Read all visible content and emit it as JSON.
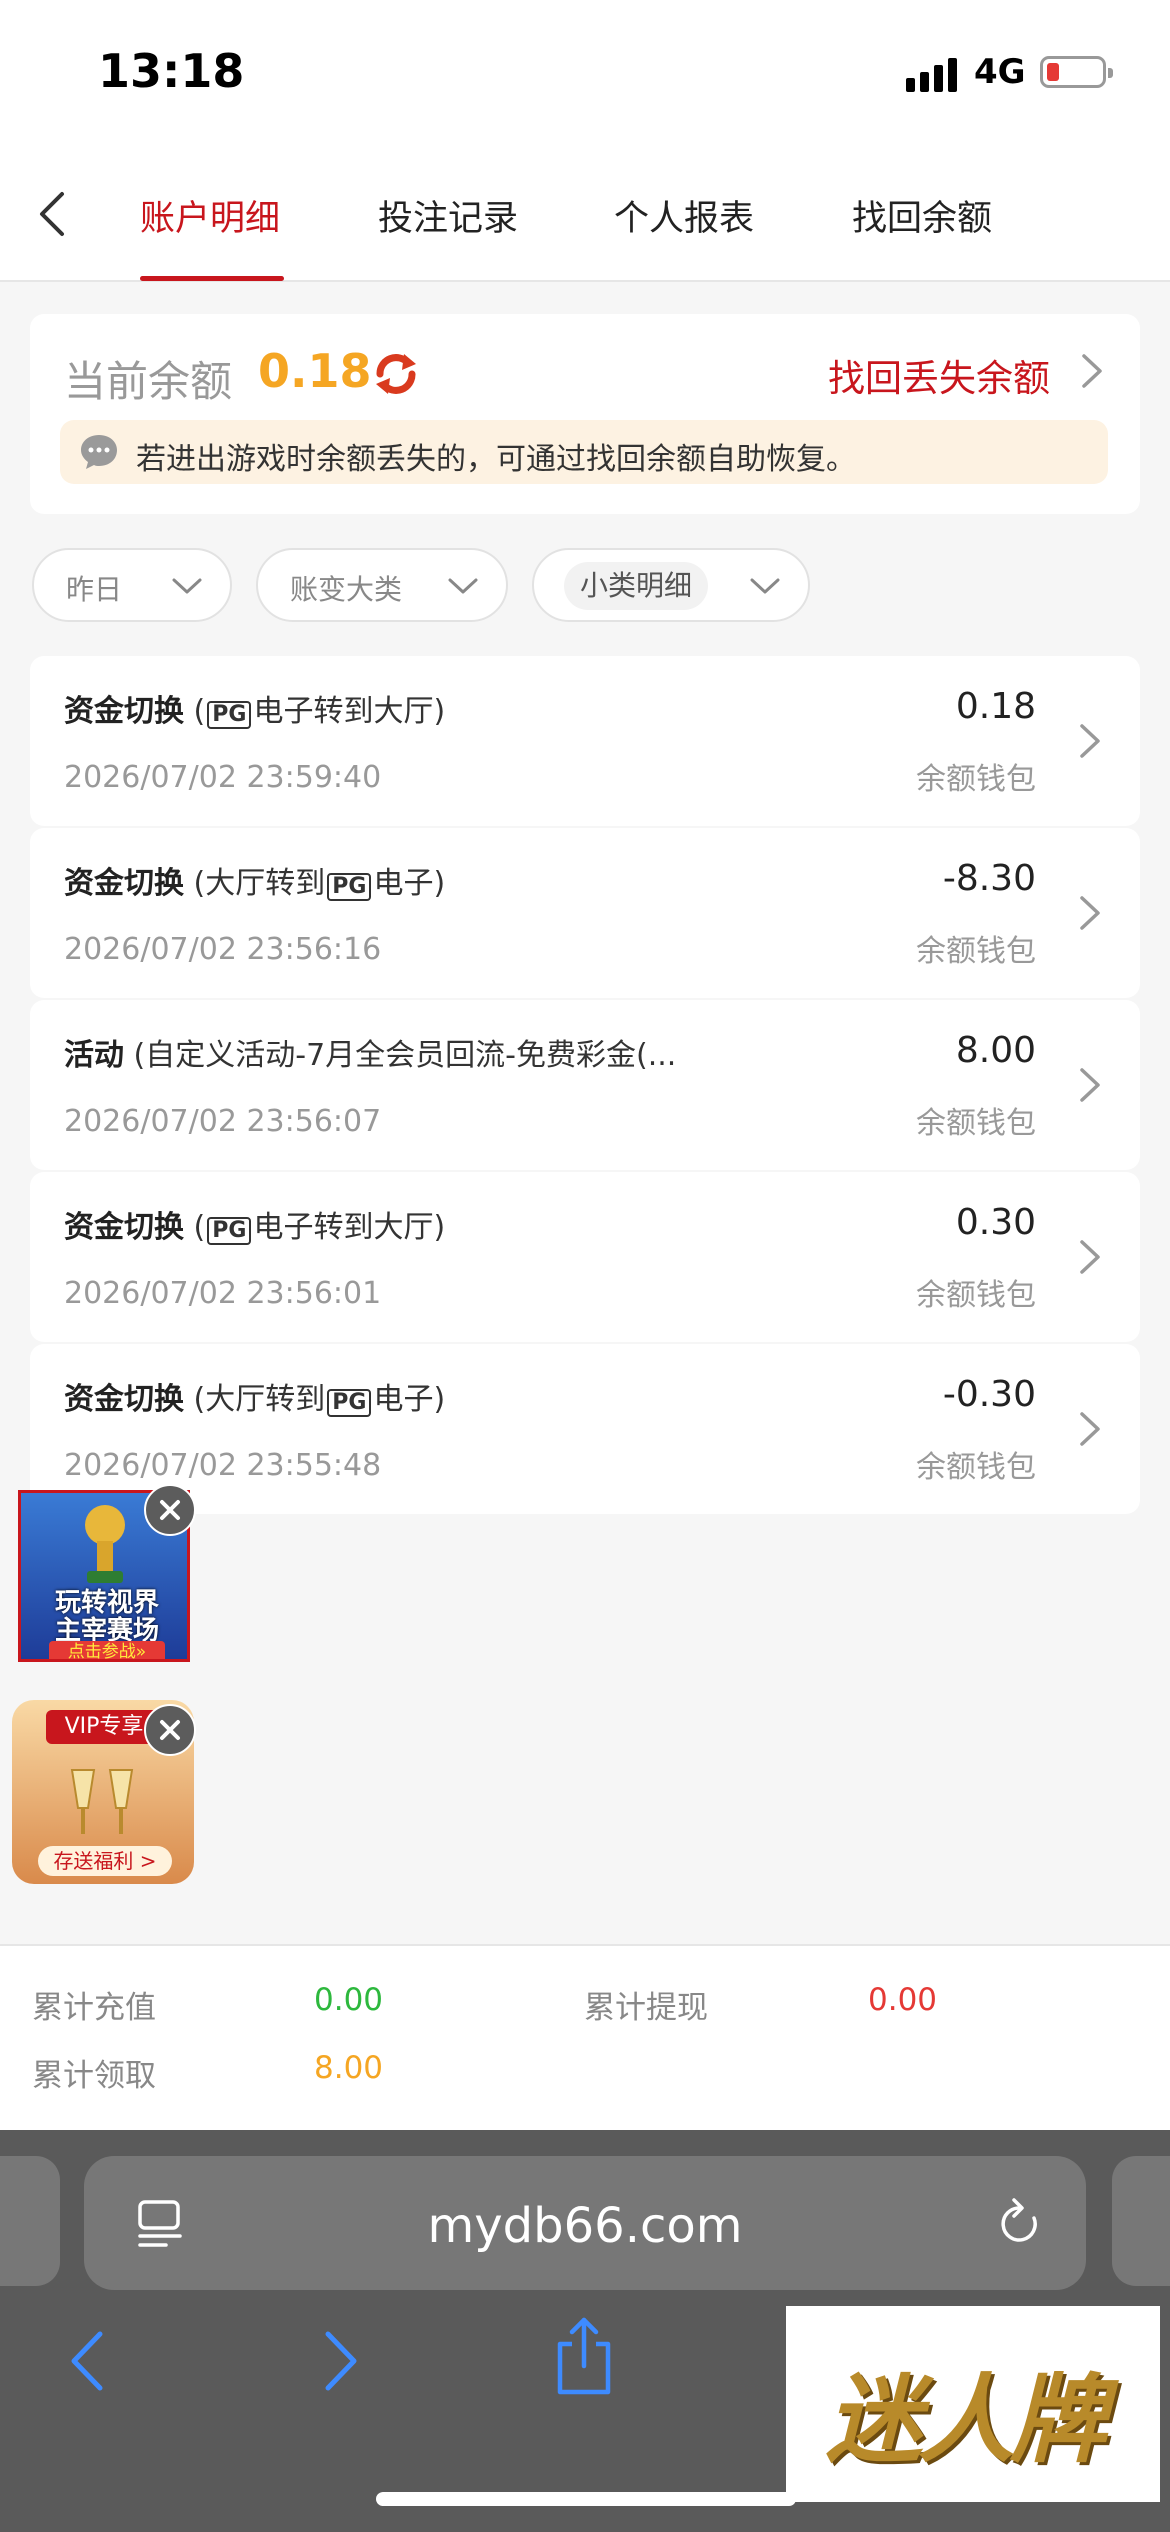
{
  "status_bar": {
    "time": "13:18",
    "network": "4G"
  },
  "nav": {
    "tabs": [
      "账户明细",
      "投注记录",
      "个人报表",
      "找回余额"
    ],
    "active_index": 0
  },
  "balance": {
    "label": "当前余额",
    "value": "0.18",
    "recover_link": "找回丢失余额",
    "notice": "若进出游戏时余额丢失的，可通过找回余额自助恢复。"
  },
  "filters": [
    {
      "label": "昨日"
    },
    {
      "label": "账变大类"
    },
    {
      "label": "小类明细"
    }
  ],
  "records": [
    {
      "type": "资金切换",
      "detail_pre": "(",
      "pg_badge": "PG",
      "detail_post": "电子转到大厅)",
      "detail_text": "",
      "time": "2026/07/02 23:59:40",
      "amount": "0.18",
      "wallet": "余额钱包"
    },
    {
      "type": "资金切换",
      "detail_pre": "(大厅转到",
      "pg_badge": "PG",
      "detail_post": "电子)",
      "detail_text": "",
      "time": "2026/07/02 23:56:16",
      "amount": "-8.30",
      "wallet": "余额钱包"
    },
    {
      "type": "活动",
      "detail_pre": "",
      "pg_badge": "",
      "detail_post": "",
      "detail_text": "(自定义活动-7月全会员回流-免费彩金(...",
      "time": "2026/07/02 23:56:07",
      "amount": "8.00",
      "wallet": "余额钱包"
    },
    {
      "type": "资金切换",
      "detail_pre": "(",
      "pg_badge": "PG",
      "detail_post": "电子转到大厅)",
      "detail_text": "",
      "time": "2026/07/02 23:56:01",
      "amount": "0.30",
      "wallet": "余额钱包"
    },
    {
      "type": "资金切换",
      "detail_pre": "(大厅转到",
      "pg_badge": "PG",
      "detail_post": "电子)",
      "detail_text": "",
      "time": "2026/07/02 23:55:48",
      "amount": "-0.30",
      "wallet": "余额钱包"
    }
  ],
  "ads": {
    "worldcup": {
      "line1": "玩转视界",
      "line2": "主宰赛场",
      "button": "点击参战»"
    },
    "vip": {
      "badge": "VIP专享",
      "button": "存送福利 >"
    }
  },
  "summary": {
    "recharge_label": "累计充值",
    "recharge_value": "0.00",
    "withdraw_label": "累计提现",
    "withdraw_value": "0.00",
    "received_label": "累计领取",
    "received_value": "8.00"
  },
  "browser": {
    "url": "mydb66.com"
  },
  "watermark": "迷人牌",
  "colors": {
    "accent": "#c8161d",
    "balance": "#f5a623",
    "green": "#2db83d",
    "red": "#e53935",
    "orange": "#f5a623"
  }
}
